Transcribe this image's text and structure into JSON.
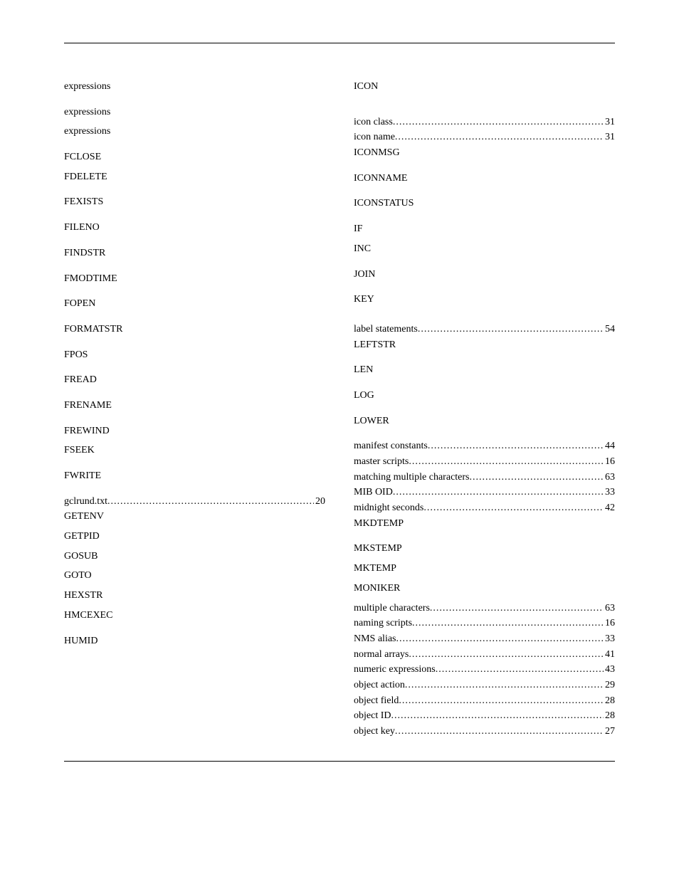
{
  "col1": [
    {
      "t": "top",
      "label": "expressions",
      "subs": []
    },
    {
      "t": "spacer"
    },
    {
      "t": "top",
      "label": "expressions",
      "subs": []
    },
    {
      "t": "spacer-sm"
    },
    {
      "t": "top",
      "label": "expressions",
      "subs": []
    },
    {
      "t": "spacer"
    },
    {
      "t": "top",
      "label": "FCLOSE",
      "subs": []
    },
    {
      "t": "spacer-sm"
    },
    {
      "t": "top",
      "label": "FDELETE",
      "subs": []
    },
    {
      "t": "spacer"
    },
    {
      "t": "top",
      "label": "FEXISTS",
      "subs": []
    },
    {
      "t": "spacer"
    },
    {
      "t": "top",
      "label": "FILENO",
      "subs": []
    },
    {
      "t": "spacer"
    },
    {
      "t": "top",
      "label": "FINDSTR",
      "subs": []
    },
    {
      "t": "spacer"
    },
    {
      "t": "top",
      "label": "FMODTIME",
      "subs": []
    },
    {
      "t": "spacer"
    },
    {
      "t": "top",
      "label": "FOPEN",
      "subs": []
    },
    {
      "t": "spacer"
    },
    {
      "t": "top",
      "label": "FORMATSTR",
      "subs": []
    },
    {
      "t": "spacer"
    },
    {
      "t": "top",
      "label": "FPOS",
      "subs": []
    },
    {
      "t": "spacer"
    },
    {
      "t": "top",
      "label": "FREAD",
      "subs": []
    },
    {
      "t": "spacer"
    },
    {
      "t": "top",
      "label": "FRENAME",
      "subs": []
    },
    {
      "t": "spacer"
    },
    {
      "t": "top",
      "label": "FREWIND",
      "subs": []
    },
    {
      "t": "spacer-sm"
    },
    {
      "t": "top",
      "label": "FSEEK",
      "subs": []
    },
    {
      "t": "spacer"
    },
    {
      "t": "top",
      "label": "FWRITE",
      "subs": []
    },
    {
      "t": "spacer"
    },
    {
      "t": "line",
      "label": "gclrund.txt",
      "page": "20"
    },
    {
      "t": "top",
      "label": "GETENV",
      "subs": []
    },
    {
      "t": "spacer-sm"
    },
    {
      "t": "top",
      "label": "GETPID",
      "subs": []
    },
    {
      "t": "spacer-sm"
    },
    {
      "t": "top",
      "label": "GOSUB",
      "subs": []
    },
    {
      "t": "spacer-sm"
    },
    {
      "t": "top",
      "label": "GOTO",
      "subs": []
    },
    {
      "t": "spacer-sm"
    },
    {
      "t": "top",
      "label": "HEXSTR",
      "subs": []
    },
    {
      "t": "spacer-sm"
    },
    {
      "t": "top",
      "label": "HMCEXEC",
      "subs": []
    },
    {
      "t": "spacer"
    },
    {
      "t": "top",
      "label": "HUMID",
      "subs": []
    }
  ],
  "col2": [
    {
      "t": "top",
      "label": "ICON",
      "subs": []
    },
    {
      "t": "spacer"
    },
    {
      "t": "spacer"
    },
    {
      "t": "line",
      "label": "icon class",
      "page": "31"
    },
    {
      "t": "line",
      "label": "icon name",
      "page": "31"
    },
    {
      "t": "top",
      "label": "ICONMSG",
      "subs": []
    },
    {
      "t": "spacer"
    },
    {
      "t": "top",
      "label": "ICONNAME",
      "subs": []
    },
    {
      "t": "spacer"
    },
    {
      "t": "top",
      "label": "ICONSTATUS",
      "subs": []
    },
    {
      "t": "spacer"
    },
    {
      "t": "top",
      "label": "IF",
      "subs": []
    },
    {
      "t": "spacer-sm"
    },
    {
      "t": "top",
      "label": "INC",
      "subs": []
    },
    {
      "t": "spacer"
    },
    {
      "t": "top",
      "label": "JOIN",
      "subs": []
    },
    {
      "t": "spacer"
    },
    {
      "t": "top",
      "label": "KEY",
      "subs": []
    },
    {
      "t": "spacer"
    },
    {
      "t": "spacer-sm"
    },
    {
      "t": "line",
      "label": "label statements",
      "page": "54"
    },
    {
      "t": "top",
      "label": "LEFTSTR",
      "subs": []
    },
    {
      "t": "spacer"
    },
    {
      "t": "top",
      "label": "LEN",
      "subs": []
    },
    {
      "t": "spacer"
    },
    {
      "t": "top",
      "label": "LOG",
      "subs": []
    },
    {
      "t": "spacer"
    },
    {
      "t": "top",
      "label": "LOWER",
      "subs": []
    },
    {
      "t": "spacer"
    },
    {
      "t": "line",
      "label": "manifest constants",
      "page": "44"
    },
    {
      "t": "line",
      "label": "master scripts",
      "page": "16"
    },
    {
      "t": "line",
      "label": "matching multiple characters",
      "page": "63"
    },
    {
      "t": "line",
      "label": "MIB OID",
      "page": "33"
    },
    {
      "t": "line",
      "label": "midnight seconds",
      "page": "42"
    },
    {
      "t": "top",
      "label": "MKDTEMP",
      "subs": []
    },
    {
      "t": "spacer"
    },
    {
      "t": "top",
      "label": "MKSTEMP",
      "subs": []
    },
    {
      "t": "spacer-sm"
    },
    {
      "t": "top",
      "label": "MKTEMP",
      "subs": []
    },
    {
      "t": "spacer-sm"
    },
    {
      "t": "top",
      "label": "MONIKER",
      "subs": []
    },
    {
      "t": "spacer-sm"
    },
    {
      "t": "line",
      "label": "multiple characters",
      "page": "63"
    },
    {
      "t": "line",
      "label": "naming scripts",
      "page": "16"
    },
    {
      "t": "line",
      "label": "NMS alias",
      "page": "33"
    },
    {
      "t": "line",
      "label": "normal arrays",
      "page": "41"
    },
    {
      "t": "line",
      "label": "numeric expressions",
      "page": "43"
    },
    {
      "t": "line",
      "label": "object action",
      "page": "29"
    },
    {
      "t": "line",
      "label": "object field",
      "page": "28"
    },
    {
      "t": "line",
      "label": "object ID",
      "page": "28"
    },
    {
      "t": "line",
      "label": "object key",
      "page": "27"
    }
  ]
}
